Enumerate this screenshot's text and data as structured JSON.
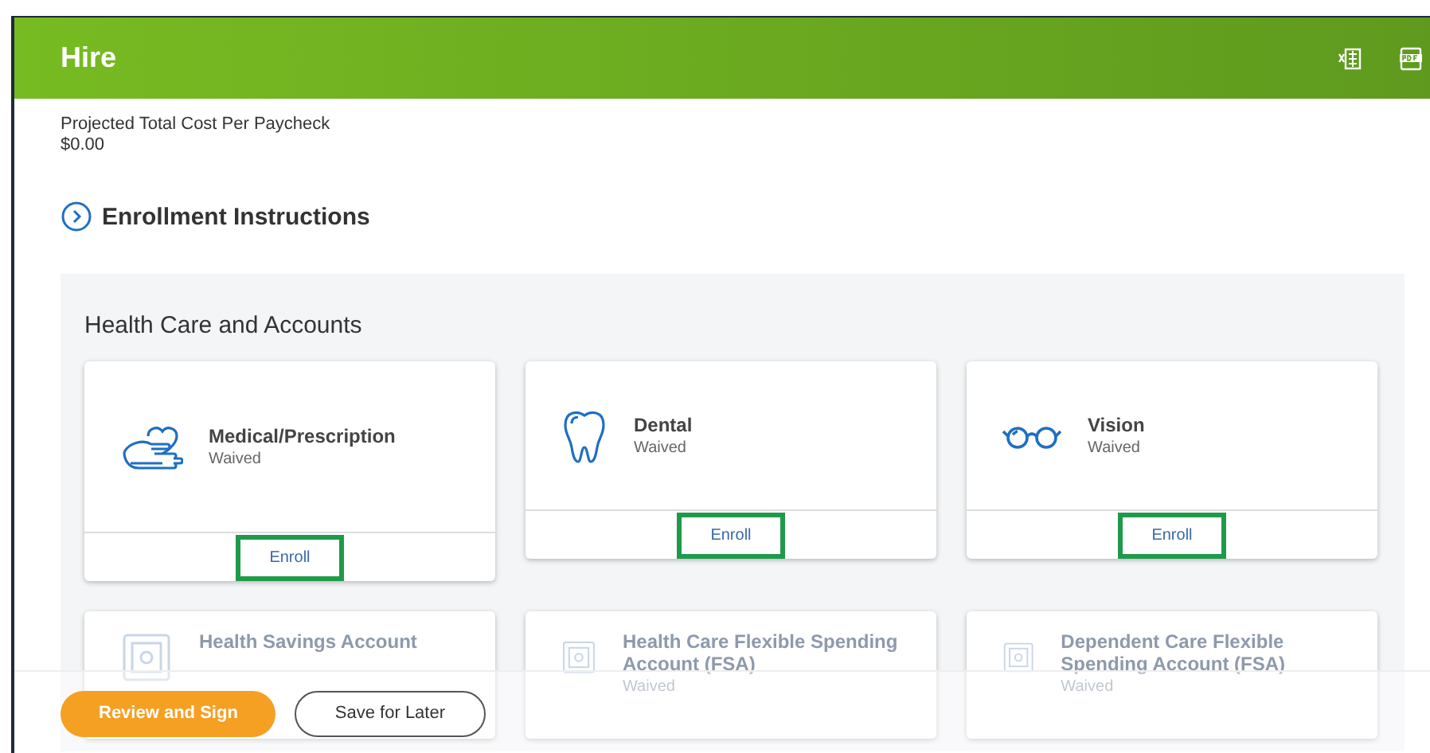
{
  "header": {
    "title": "Hire",
    "actions": [
      {
        "kind": "excel"
      },
      {
        "kind": "pdf"
      }
    ]
  },
  "summary": {
    "label": "Projected Total Cost Per Paycheck",
    "value": "$0.00"
  },
  "instructions": {
    "label": "Enrollment Instructions"
  },
  "section": {
    "title": "Health Care and Accounts",
    "cards": [
      {
        "kind": "medical",
        "title": "Medical/Prescription",
        "status": "Waived",
        "action": "Enroll",
        "highlighted": true
      },
      {
        "kind": "dental",
        "title": "Dental",
        "status": "Waived",
        "action": "Enroll",
        "highlighted": true
      },
      {
        "kind": "vision",
        "title": "Vision",
        "status": "Waived",
        "action": "Enroll",
        "highlighted": true
      },
      {
        "kind": "safe",
        "title": "Health Savings Account"
      },
      {
        "kind": "safe",
        "title": "Health Care Flexible Spending Account (FSA)",
        "status": "Waived"
      },
      {
        "kind": "safe",
        "title": "Dependent Care Flexible Spending Account (FSA)",
        "status": "Waived"
      }
    ]
  },
  "footer": {
    "buttons": [
      {
        "label": "Review and Sign",
        "kind": "primary"
      },
      {
        "label": "Save for Later",
        "kind": "secondary"
      }
    ]
  }
}
